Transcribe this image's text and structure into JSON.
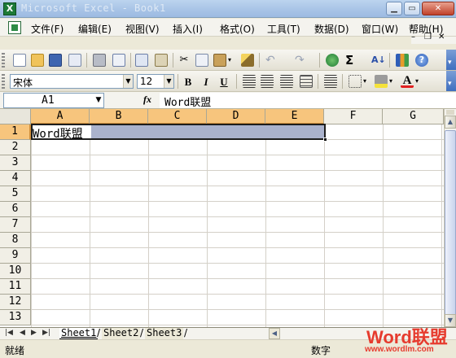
{
  "window": {
    "title": "Microsoft Excel - Book1"
  },
  "menu": {
    "items": [
      "文件(F)",
      "编辑(E)",
      "视图(V)",
      "插入(I)",
      "格式(O)",
      "工具(T)",
      "数据(D)",
      "窗口(W)",
      "帮助(H)"
    ]
  },
  "format_toolbar": {
    "font_name": "宋体",
    "font_size": "12"
  },
  "formula_bar": {
    "cell_ref": "A1",
    "fx_label": "fx",
    "content": "Word联盟"
  },
  "grid": {
    "columns": [
      "A",
      "B",
      "C",
      "D",
      "E",
      "F",
      "G"
    ],
    "rows": [
      "1",
      "2",
      "3",
      "4",
      "5",
      "6",
      "7",
      "8",
      "9",
      "10",
      "11",
      "12",
      "13"
    ],
    "a1_value": "Word联盟",
    "selection": "A1:E1"
  },
  "sheets": [
    "Sheet1",
    "Sheet2",
    "Sheet3"
  ],
  "active_sheet": "Sheet1",
  "status": {
    "ready": "就绪",
    "mode": "数字"
  },
  "watermark": {
    "brand": "Word联盟",
    "url": "www.wordlm.com"
  },
  "colors": {
    "selection_fill": "#aab2cc",
    "header_highlight": "#f7c57d"
  }
}
